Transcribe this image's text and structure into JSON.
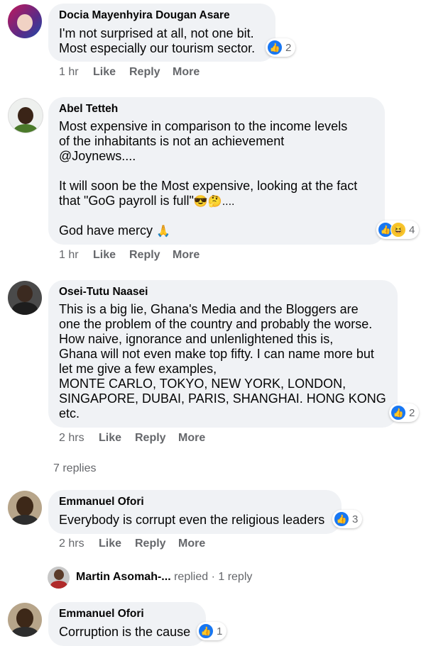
{
  "comments": [
    {
      "author": "Docia Mayenhyira Dougan Asare",
      "lines": [
        "I'm not surprised at all, not one bit.",
        "Most especially our tourism sector."
      ],
      "reactions": {
        "count": "2"
      },
      "meta": {
        "time": "1 hr",
        "like": "Like",
        "reply": "Reply",
        "more": "More"
      }
    },
    {
      "author": "Abel Tetteh",
      "lines": [
        "Most expensive in comparison to the income levels",
        "of the inhabitants is not an achievement",
        "@Joynews....",
        "",
        "It will soon be the Most expensive, looking at the fact",
        "that \"GoG payroll is full\"",
        "",
        "God have mercy"
      ],
      "emoji_after_payroll": "😎🤔....",
      "emoji_after_mercy": "🙏",
      "reactions": {
        "count": "4"
      },
      "meta": {
        "time": "1 hr",
        "like": "Like",
        "reply": "Reply",
        "more": "More"
      }
    },
    {
      "author": "Osei-Tutu Naasei",
      "lines": [
        "This is a big lie, Ghana's Media and the Bloggers are",
        "one the problem of the country and probably the worse.",
        "How naive, ignorance and unlenlightened this is,",
        "Ghana will not even make top fifty. I can name more but",
        "let me give a few examples,",
        "MONTE CARLO, TOKYO, NEW YORK, LONDON,",
        "SINGAPORE, DUBAI, PARIS, SHANGHAI. HONG KONG",
        "etc."
      ],
      "reactions": {
        "count": "2"
      },
      "meta": {
        "time": "2 hrs",
        "like": "Like",
        "reply": "Reply",
        "more": "More"
      },
      "replies_link": "7 replies"
    },
    {
      "author": "Emmanuel Ofori",
      "lines": [
        "Everybody is corrupt even the religious leaders"
      ],
      "reactions": {
        "count": "3"
      },
      "meta": {
        "time": "2 hrs",
        "like": "Like",
        "reply": "Reply",
        "more": "More"
      },
      "replied_by": {
        "name": "Martin Asomah-...",
        "action": "replied",
        "sep": "·",
        "count": "1 reply"
      }
    },
    {
      "author": "Emmanuel Ofori",
      "lines": [
        "Corruption is the cause"
      ],
      "reactions": {
        "count": "1"
      }
    }
  ],
  "colors": {
    "bubble": "#f0f2f5",
    "meta": "#65676b",
    "like_blue": "#1877f2"
  },
  "icons": {
    "like": "thumbs-up-icon",
    "haha": "haha-icon"
  }
}
